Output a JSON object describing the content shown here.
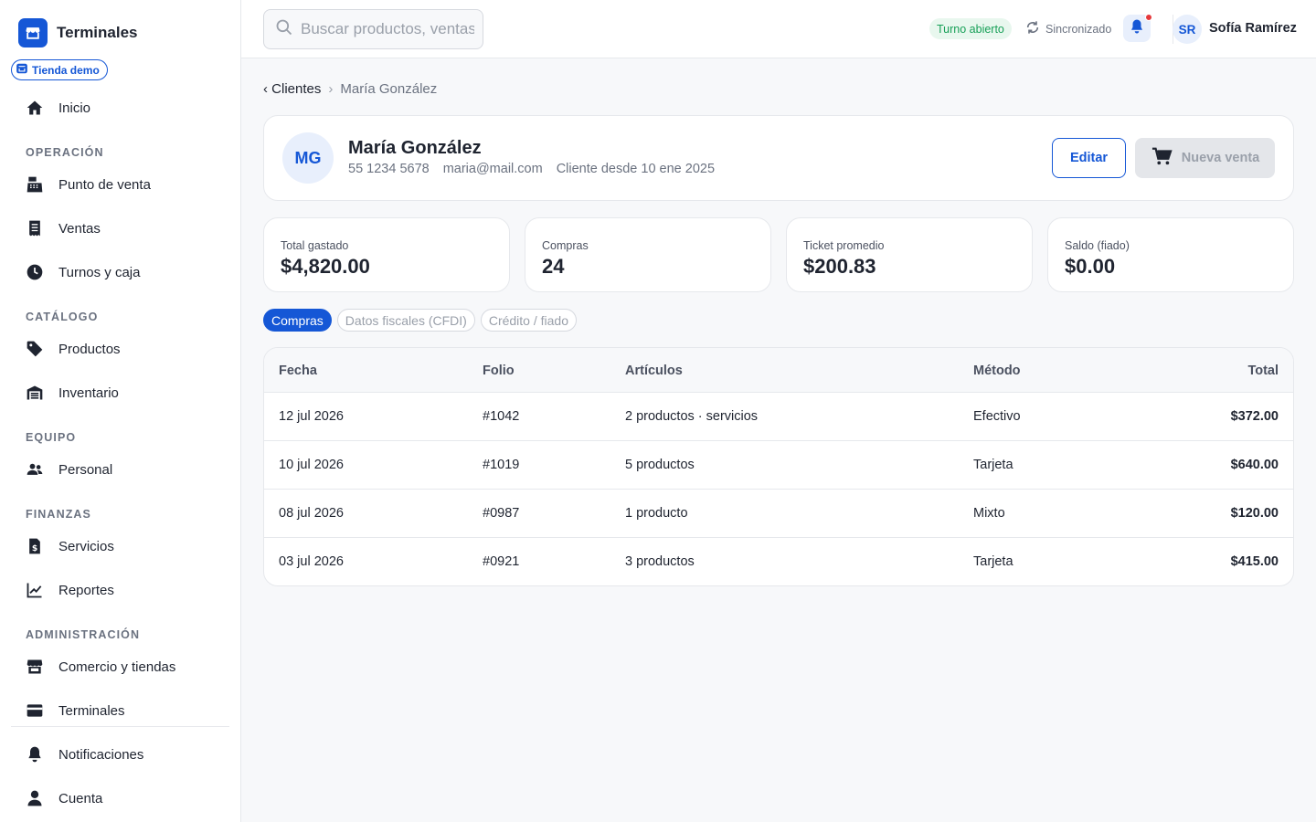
{
  "brand": {
    "name": "Terminales",
    "store_badge": "Tienda demo"
  },
  "sidebar": {
    "home": "Inicio",
    "sections": {
      "operacion": "OPERACIÓN",
      "catalogo": "CATÁLOGO",
      "equipo": "EQUIPO",
      "finanzas": "FINANZAS",
      "administracion": "ADMINISTRACIÓN"
    },
    "items": {
      "punto_de_venta": "Punto de venta",
      "ventas": "Ventas",
      "turnos": "Turnos y caja",
      "productos": "Productos",
      "inventario": "Inventario",
      "personal": "Personal",
      "servicios": "Servicios",
      "reportes": "Reportes",
      "comercio": "Comercio y tiendas",
      "terminales": "Terminales",
      "notificaciones": "Notificaciones",
      "cuenta": "Cuenta"
    }
  },
  "topbar": {
    "search_placeholder": "Buscar productos, ventas",
    "shift_status": "Turno abierto",
    "sync_status": "Sincronizado",
    "user_initials": "SR",
    "user_name": "Sofía Ramírez"
  },
  "breadcrumb": {
    "back": "‹ Clientes",
    "separator": "›",
    "current": "María González"
  },
  "customer": {
    "initials": "MG",
    "name": "María González",
    "phone": "55 1234 5678",
    "email": "maria@mail.com",
    "since": "Cliente desde 10 ene 2025",
    "edit_label": "Editar",
    "new_sale_label": "Nueva venta"
  },
  "stats": [
    {
      "label": "Total gastado",
      "value": "$4,820.00"
    },
    {
      "label": "Compras",
      "value": "24"
    },
    {
      "label": "Ticket promedio",
      "value": "$200.83"
    },
    {
      "label": "Saldo (fiado)",
      "value": "$0.00"
    }
  ],
  "tabs": [
    "Compras",
    "Datos fiscales (CFDI)",
    "Crédito / fiado"
  ],
  "table": {
    "headers": [
      "Fecha",
      "Folio",
      "Artículos",
      "Método",
      "Total"
    ],
    "rows": [
      [
        "12 jul 2026",
        "#1042",
        "2 productos · servicios",
        "Efectivo",
        "$372.00"
      ],
      [
        "10 jul 2026",
        "#1019",
        "5 productos",
        "Tarjeta",
        "$640.00"
      ],
      [
        "08 jul 2026",
        "#0987",
        "1 producto",
        "Mixto",
        "$120.00"
      ],
      [
        "03 jul 2026",
        "#0921",
        "3 productos",
        "Tarjeta",
        "$415.00"
      ]
    ]
  },
  "colors": {
    "accent": "#1557d6",
    "success": "#18a058",
    "alert": "#e5383b",
    "text": "#1f2430",
    "muted": "#6b7280"
  }
}
